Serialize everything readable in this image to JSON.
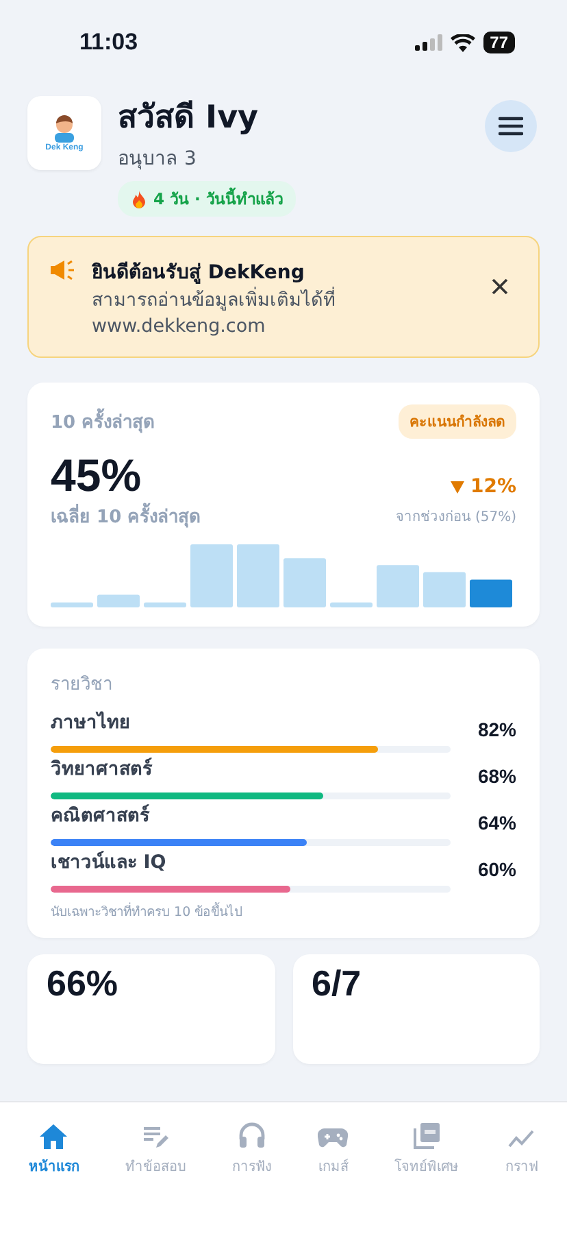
{
  "status_bar": {
    "time": "11:03",
    "battery": "77"
  },
  "header": {
    "logo_text": "Dek Keng",
    "greeting": "สวัสดี Ivy",
    "grade": "อนุบาล 3",
    "streak": "4 วัน · วันนี้ทำแล้ว"
  },
  "banner": {
    "title": "ยินดีต้อนรับสู่ DekKeng",
    "body": "สามารถอ่านข้อมูลเพิ่มเติมได้ที่ www.dekkeng.com"
  },
  "recent": {
    "label": "10 ครั้งล่าสุด",
    "badge": "คะแนนกำลังลด",
    "score": "45%",
    "score_caption": "เฉลี่ย 10 ครั้งล่าสุด",
    "change": "12%",
    "change_caption": "จากช่วงก่อน (57%)"
  },
  "subjects": {
    "title": "รายวิชา",
    "items": [
      {
        "name": "ภาษาไทย",
        "value": "82%",
        "level": 0.82,
        "color": "#f59e0b"
      },
      {
        "name": "วิทยาศาสตร์",
        "value": "68%",
        "level": 0.68,
        "color": "#10b981"
      },
      {
        "name": "คณิตศาสตร์",
        "value": "64%",
        "level": 0.64,
        "color": "#3b82f6"
      },
      {
        "name": "เชาวน์และ IQ",
        "value": "60%",
        "level": 0.6,
        "color": "#e8688e"
      }
    ],
    "note": "นับเฉพาะวิชาที่ทำครบ 10 ข้อขึ้นไป"
  },
  "summary_cards": [
    "66%",
    "6/7"
  ],
  "tabs": [
    {
      "label": "หน้าแรก",
      "kind": "home",
      "selected": true
    },
    {
      "label": "ทำข้อสอบ",
      "kind": "exam",
      "selected": false
    },
    {
      "label": "การฟัง",
      "kind": "listen",
      "selected": false
    },
    {
      "label": "เกมส์",
      "kind": "game",
      "selected": false
    },
    {
      "label": "โจทย์พิเศษ",
      "kind": "pdf",
      "selected": false
    },
    {
      "label": "กราฟ",
      "kind": "graph",
      "selected": false
    }
  ]
}
